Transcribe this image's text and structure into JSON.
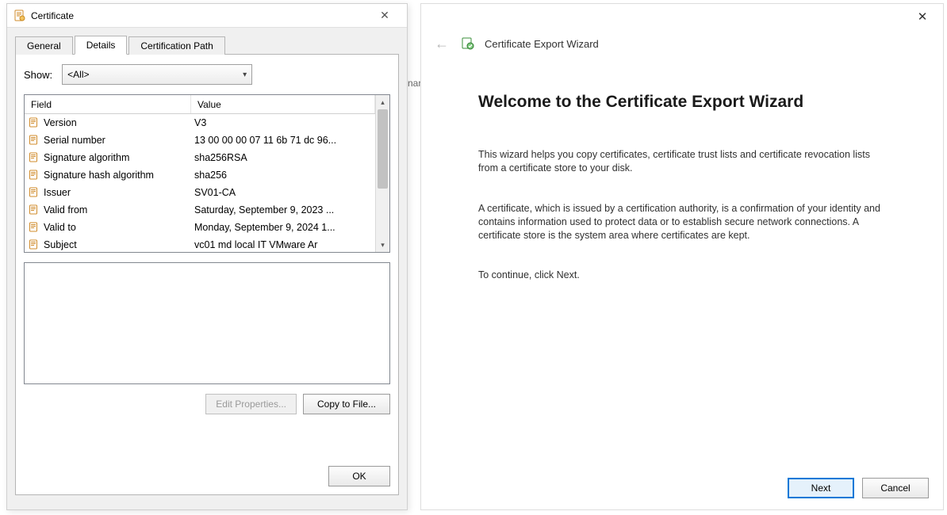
{
  "cert_dialog": {
    "title": "Certificate",
    "tabs": {
      "general": "General",
      "details": "Details",
      "path": "Certification Path"
    },
    "show_label": "Show:",
    "show_value": "<All>",
    "columns": {
      "field": "Field",
      "value": "Value"
    },
    "rows": [
      {
        "field": "Version",
        "value": "V3"
      },
      {
        "field": "Serial number",
        "value": "13 00 00 00 07 11 6b 71 dc 96..."
      },
      {
        "field": "Signature algorithm",
        "value": "sha256RSA"
      },
      {
        "field": "Signature hash algorithm",
        "value": "sha256"
      },
      {
        "field": "Issuer",
        "value": "SV01-CA"
      },
      {
        "field": "Valid from",
        "value": "Saturday, September 9, 2023 ..."
      },
      {
        "field": "Valid to",
        "value": "Monday, September 9, 2024 1..."
      },
      {
        "field": "Subject",
        "value": "vc01 md local  IT  VMware Ar"
      }
    ],
    "buttons": {
      "edit": "Edit Properties...",
      "copy": "Copy to File...",
      "ok": "OK"
    }
  },
  "wizard": {
    "header_title": "Certificate Export Wizard",
    "heading": "Welcome to the Certificate Export Wizard",
    "para1": "This wizard helps you copy certificates, certificate trust lists and certificate revocation lists from a certificate store to your disk.",
    "para2": "A certificate, which is issued by a certification authority, is a confirmation of your identity and contains information used to protect data or to establish secure network connections. A certificate store is the system area where certificates are kept.",
    "para3": "To continue, click Next.",
    "buttons": {
      "next": "Next",
      "cancel": "Cancel"
    }
  },
  "bg_hint": "nar"
}
